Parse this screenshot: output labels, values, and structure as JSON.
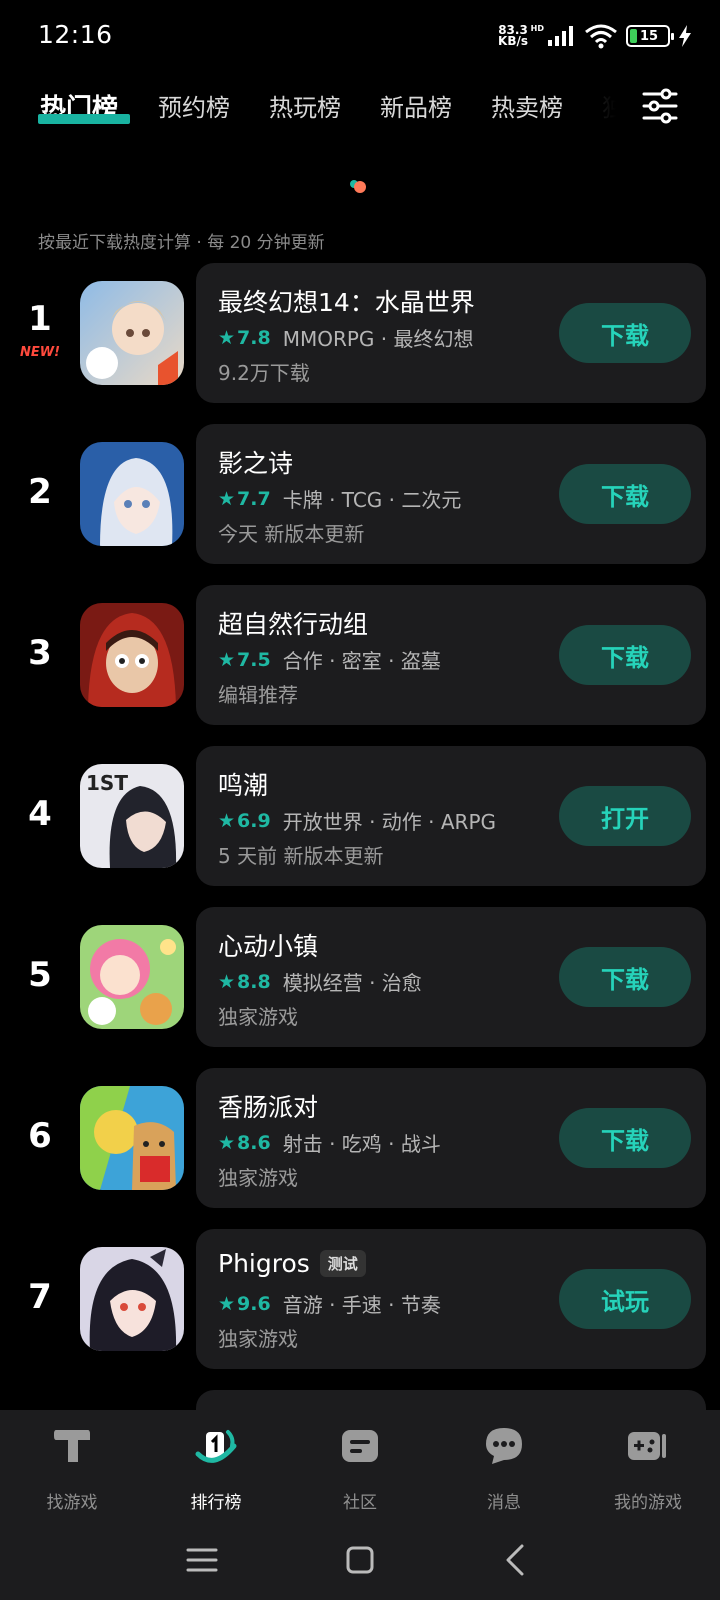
{
  "status_bar": {
    "time": "12:16",
    "net_speed_value": "83.3",
    "net_speed_unit": "KB/s",
    "net_type": "HD",
    "battery": "15"
  },
  "tabs": [
    {
      "label": "热门榜",
      "active": true
    },
    {
      "label": "预约榜",
      "active": false
    },
    {
      "label": "热玩榜",
      "active": false
    },
    {
      "label": "新品榜",
      "active": false
    },
    {
      "label": "热卖榜",
      "active": false
    },
    {
      "label": "独",
      "active": false
    }
  ],
  "hint": "按最近下载热度计算 · 每 20 分钟更新",
  "games": [
    {
      "rank": "1",
      "badge": "NEW!",
      "title": "最终幻想14：水晶世界",
      "score": "7.8",
      "tags": "MMORPG · 最终幻想",
      "sub": "9.2万下载",
      "action": "下载"
    },
    {
      "rank": "2",
      "title": "影之诗",
      "score": "7.7",
      "tags": "卡牌 · TCG · 二次元",
      "sub": "今天 新版本更新",
      "action": "下载"
    },
    {
      "rank": "3",
      "title": "超自然行动组",
      "score": "7.5",
      "tags": "合作 · 密室 · 盗墓",
      "sub": "编辑推荐",
      "action": "下载"
    },
    {
      "rank": "4",
      "title": "鸣潮",
      "score": "6.9",
      "tags": "开放世界 · 动作 · ARPG",
      "sub": "5 天前 新版本更新",
      "action": "打开"
    },
    {
      "rank": "5",
      "title": "心动小镇",
      "score": "8.8",
      "tags": "模拟经营 · 治愈",
      "sub": "独家游戏",
      "action": "下载"
    },
    {
      "rank": "6",
      "title": "香肠派对",
      "score": "8.6",
      "tags": "射击 · 吃鸡 · 战斗",
      "sub": "独家游戏",
      "action": "下载"
    },
    {
      "rank": "7",
      "title": "Phigros",
      "tag": "测试",
      "score": "9.6",
      "tags": "音游 · 手速 · 节奏",
      "sub": "独家游戏",
      "action": "试玩"
    }
  ],
  "bottom_nav": [
    {
      "label": "找游戏",
      "icon": "find-games-icon",
      "active": false
    },
    {
      "label": "排行榜",
      "icon": "ranking-icon",
      "active": true
    },
    {
      "label": "社区",
      "icon": "community-icon",
      "active": false
    },
    {
      "label": "消息",
      "icon": "message-icon",
      "active": false
    },
    {
      "label": "我的游戏",
      "icon": "my-games-icon",
      "active": false
    }
  ],
  "colors": {
    "accent": "#1fb8a3",
    "button_bg": "#1a4a43",
    "button_text": "#26d3ba",
    "card_bg": "#1c1c1e",
    "new_badge": "#ff4a3d"
  }
}
